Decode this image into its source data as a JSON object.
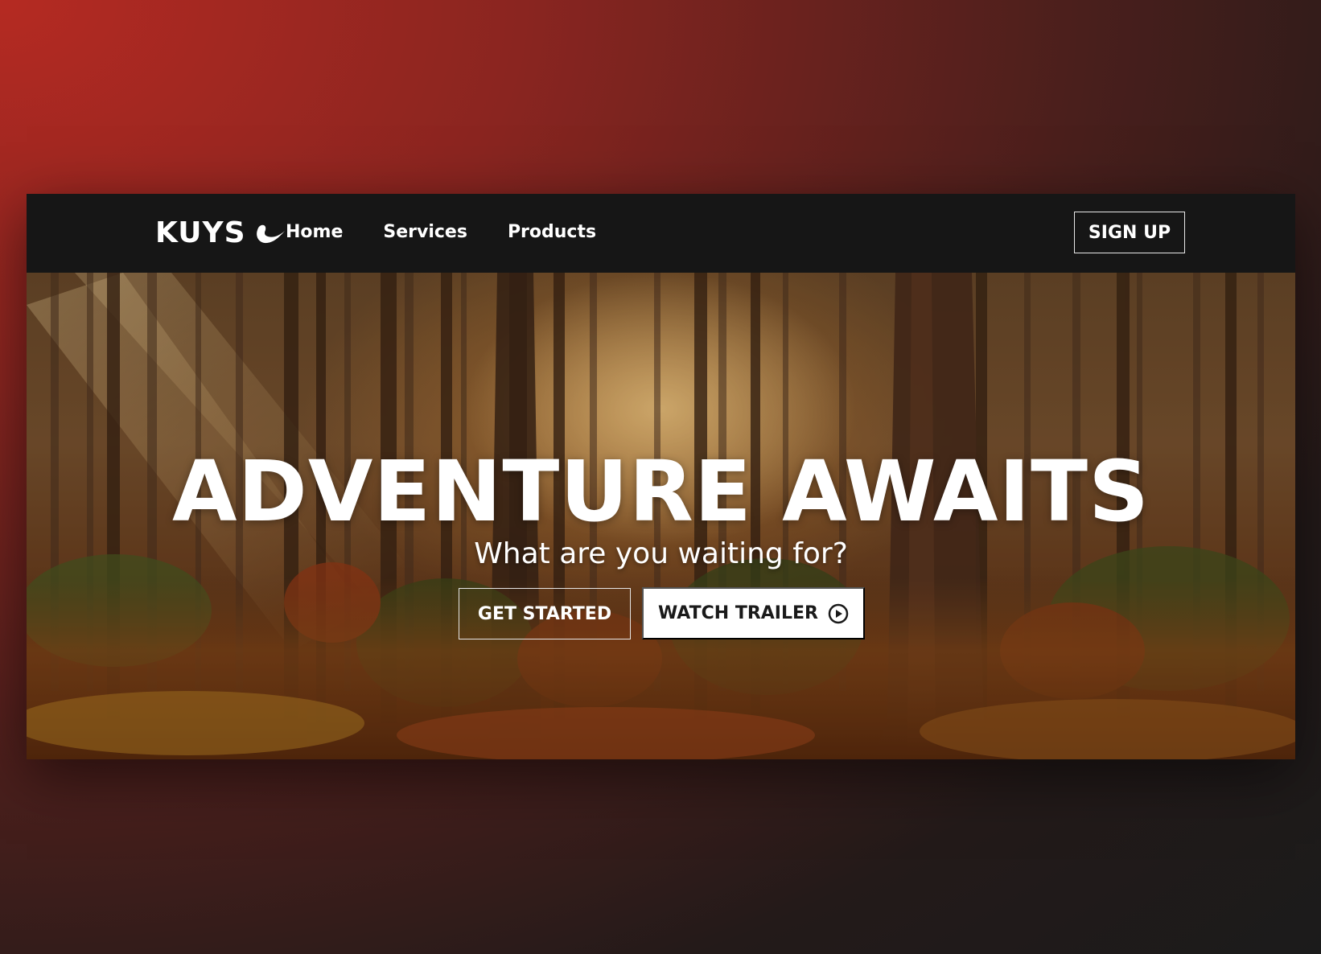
{
  "brand": {
    "name": "KUYS",
    "logo_icon": "wave-swoosh-icon"
  },
  "nav": {
    "items": [
      {
        "label": "Home"
      },
      {
        "label": "Services"
      },
      {
        "label": "Products"
      }
    ],
    "signup_label": "SIGN UP"
  },
  "hero": {
    "headline": "ADVENTURE AWAITS",
    "subheadline": "What are you waiting for?",
    "primary_button": "GET STARTED",
    "secondary_button": "WATCH TRAILER",
    "secondary_icon": "play-circle-icon",
    "background_image": "sunlit autumn forest"
  },
  "colors": {
    "navbar": "#161616",
    "page_background_accent": "#b52a22",
    "button_light": "#ffffff",
    "text_light": "#ffffff"
  }
}
